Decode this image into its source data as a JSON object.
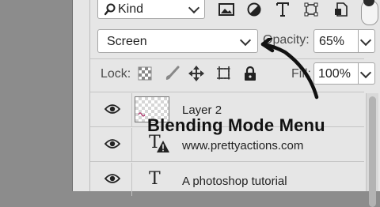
{
  "filter": {
    "kind_label": "Kind",
    "icons": [
      "image-icon",
      "adjustment-icon",
      "type-icon",
      "shape-icon",
      "smart-object-icon"
    ]
  },
  "blend": {
    "mode": "Screen"
  },
  "opacity": {
    "label": "Opacity:",
    "value": "65%"
  },
  "lock": {
    "label": "Lock:",
    "icons": [
      "lock-transparent-pixels-icon",
      "lock-image-pixels-icon",
      "lock-position-icon",
      "lock-artboard-icon",
      "lock-all-icon"
    ]
  },
  "fill": {
    "label": "Fill:",
    "value": "100%"
  },
  "layers": [
    {
      "name": "Layer 2",
      "type": "pixel"
    },
    {
      "name": "www.prettyactions.com",
      "type": "text-warning"
    },
    {
      "name": "A photoshop tutorial",
      "type": "text"
    }
  ],
  "annotation": {
    "text": "Blending Mode Menu"
  },
  "colors": {
    "panel": "#e6e6e6",
    "background": "#8c8c8c"
  }
}
